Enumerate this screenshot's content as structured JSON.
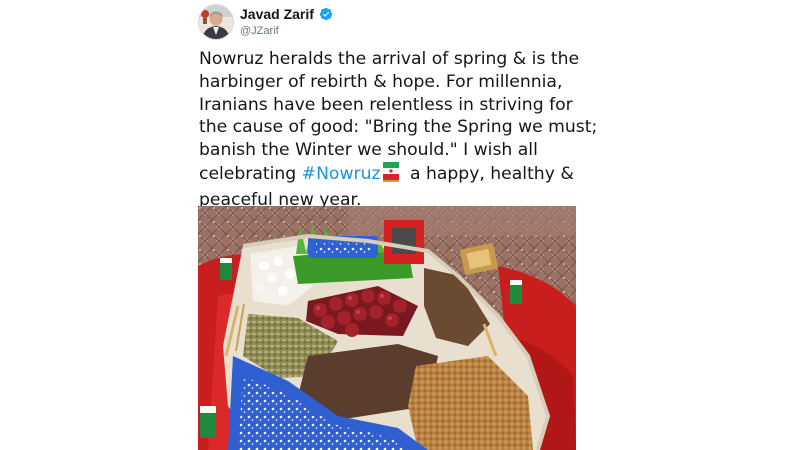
{
  "tweet": {
    "author": {
      "name": "Javad Zarif",
      "handle": "@JZarif",
      "verified": true,
      "verified_color": "#1da1f2"
    },
    "text_before_hashtag": "Nowruz heralds the arrival of spring & is the\nharbinger of rebirth & hope. For millennia,\nIranians have been relentless in striving for\nthe cause of good: \"Bring the Spring we must;\nbanish the Winter we should.\" I wish all\ncelebrating ",
    "hashtag": "#Nowruz",
    "flag_icon": "iran-flag-icon",
    "text_after_hashtag": " a happy, healthy &\npeaceful new year.",
    "colors": {
      "text": "#14171a",
      "secondary": "#657786",
      "link": "#1b95e0"
    },
    "media": {
      "kind": "photo",
      "subject": "haft-sin-table-icon"
    }
  }
}
